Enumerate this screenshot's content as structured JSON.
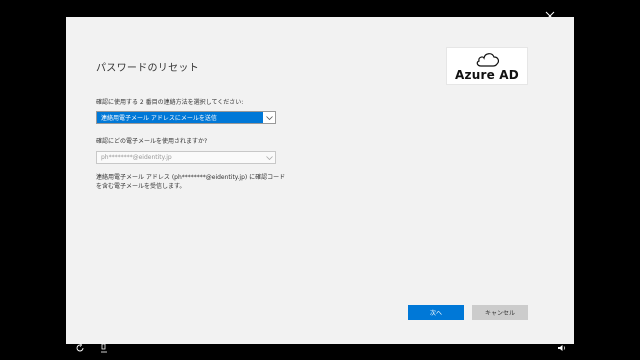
{
  "dialog": {
    "title": "パスワードのリセット",
    "logo": {
      "text": "Azure AD"
    },
    "method_label": "確認に使用する 2 番目の連絡方法を選択してください:",
    "method_select": {
      "value": "連絡用電子メール アドレスにメールを送信"
    },
    "email_label": "確認にどの電子メールを使用されますか?",
    "email_select": {
      "value": "ph********@eidentity.jp"
    },
    "description": "連絡用電子メール アドレス (ph********@eidentity.jp) に確認コードを含む電子メールを受信します。",
    "next_button": "次へ",
    "cancel_button": "キャンセル"
  },
  "colors": {
    "accent": "#0078d7",
    "dialog_bg": "#f2f2f2",
    "screen_bg": "#000000",
    "cancel_bg": "#cccccc"
  }
}
